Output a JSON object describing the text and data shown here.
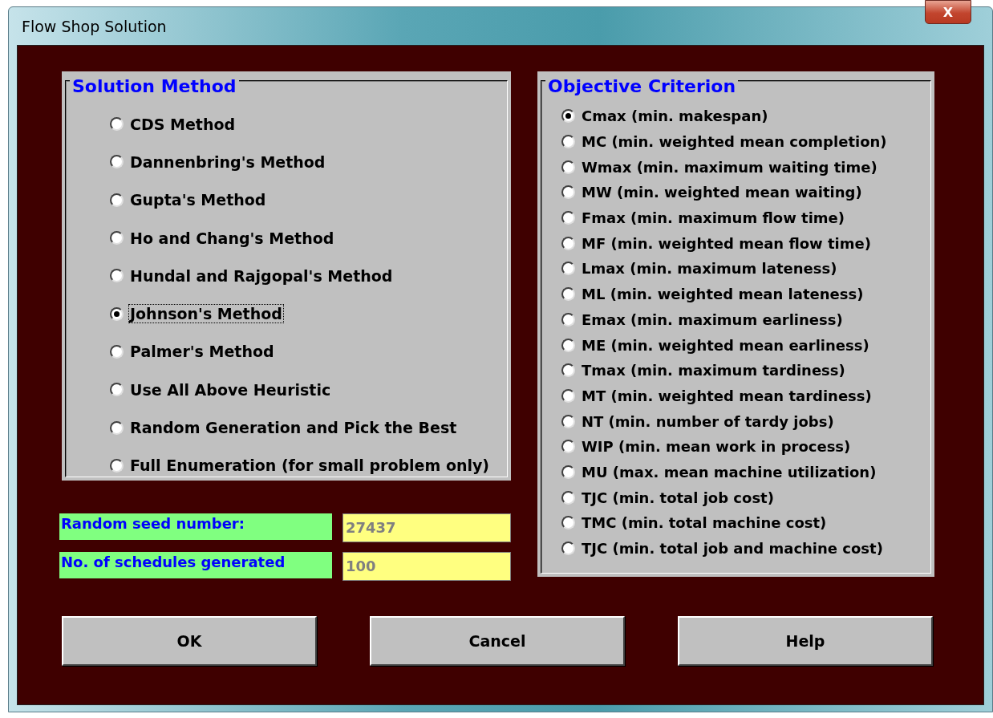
{
  "window": {
    "title": "Flow Shop Solution",
    "close": "X"
  },
  "solution_method": {
    "title": "Solution Method",
    "options": [
      {
        "label": "CDS Method",
        "selected": false
      },
      {
        "label": "Dannenbring's Method",
        "selected": false
      },
      {
        "label": "Gupta's Method",
        "selected": false
      },
      {
        "label": "Ho and Chang's Method",
        "selected": false
      },
      {
        "label": "Hundal and Rajgopal's Method",
        "selected": false
      },
      {
        "label": "Johnson's Method",
        "selected": true
      },
      {
        "label": "Palmer's Method",
        "selected": false
      },
      {
        "label": "Use All Above Heuristic",
        "selected": false
      },
      {
        "label": "Random Generation and Pick the Best",
        "selected": false
      },
      {
        "label": "Full Enumeration (for small problem only)",
        "selected": false
      }
    ]
  },
  "fields": [
    {
      "label": "Random seed number:",
      "value": "27437"
    },
    {
      "label": "No. of schedules generated",
      "value": "100"
    }
  ],
  "objective_criterion": {
    "title": "Objective Criterion",
    "options": [
      {
        "label": "Cmax (min. makespan)",
        "selected": true
      },
      {
        "label": "MC (min. weighted mean completion)",
        "selected": false
      },
      {
        "label": "Wmax (min. maximum waiting time)",
        "selected": false
      },
      {
        "label": "MW (min. weighted mean waiting)",
        "selected": false
      },
      {
        "label": "Fmax (min. maximum flow time)",
        "selected": false
      },
      {
        "label": "MF (min. weighted mean flow time)",
        "selected": false
      },
      {
        "label": "Lmax (min. maximum lateness)",
        "selected": false
      },
      {
        "label": "ML (min. weighted mean lateness)",
        "selected": false
      },
      {
        "label": "Emax (min. maximum earliness)",
        "selected": false
      },
      {
        "label": "ME (min. weighted mean earliness)",
        "selected": false
      },
      {
        "label": "Tmax (min. maximum tardiness)",
        "selected": false
      },
      {
        "label": "MT (min. weighted mean tardiness)",
        "selected": false
      },
      {
        "label": "NT (min. number of tardy jobs)",
        "selected": false
      },
      {
        "label": "WIP (min. mean work in process)",
        "selected": false
      },
      {
        "label": "MU (max. mean machine utilization)",
        "selected": false
      },
      {
        "label": "TJC (min. total job cost)",
        "selected": false
      },
      {
        "label": "TMC (min. total machine cost)",
        "selected": false
      },
      {
        "label": "TJC (min. total job and machine cost)",
        "selected": false
      }
    ]
  },
  "buttons": [
    "OK",
    "Cancel",
    "Help"
  ]
}
